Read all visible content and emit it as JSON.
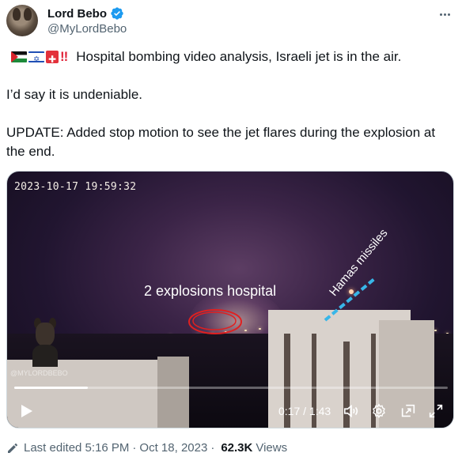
{
  "author": {
    "display_name": "Lord Bebo",
    "handle": "@MyLordBebo"
  },
  "tweet": {
    "line1_emoji": "🇵🇸🇮🇱🚑‼️",
    "line1": "Hospital bombing video analysis, Israeli jet is in the air.",
    "line2": "I’d say it is undeniable.",
    "line3": "UPDATE: Added stop motion to see the jet flares during the explosion at the end."
  },
  "video": {
    "timestamp": "2023-10-17 19:59:32",
    "overlay_label_explosions": "2 explosions hospital",
    "overlay_label_missiles": "Hamas missiles",
    "watermark": "@MYLORDBEBO",
    "progress_fraction": 0.17,
    "time_display": "0:17 / 1:43"
  },
  "footer": {
    "edited": "Last edited 5:16 PM",
    "date": "Oct 18, 2023",
    "views_count": "62.3K",
    "views_label": "Views"
  },
  "colors": {
    "verified": "#1d9bf0",
    "secondary_text": "#536471",
    "primary_text": "#0f1419"
  }
}
